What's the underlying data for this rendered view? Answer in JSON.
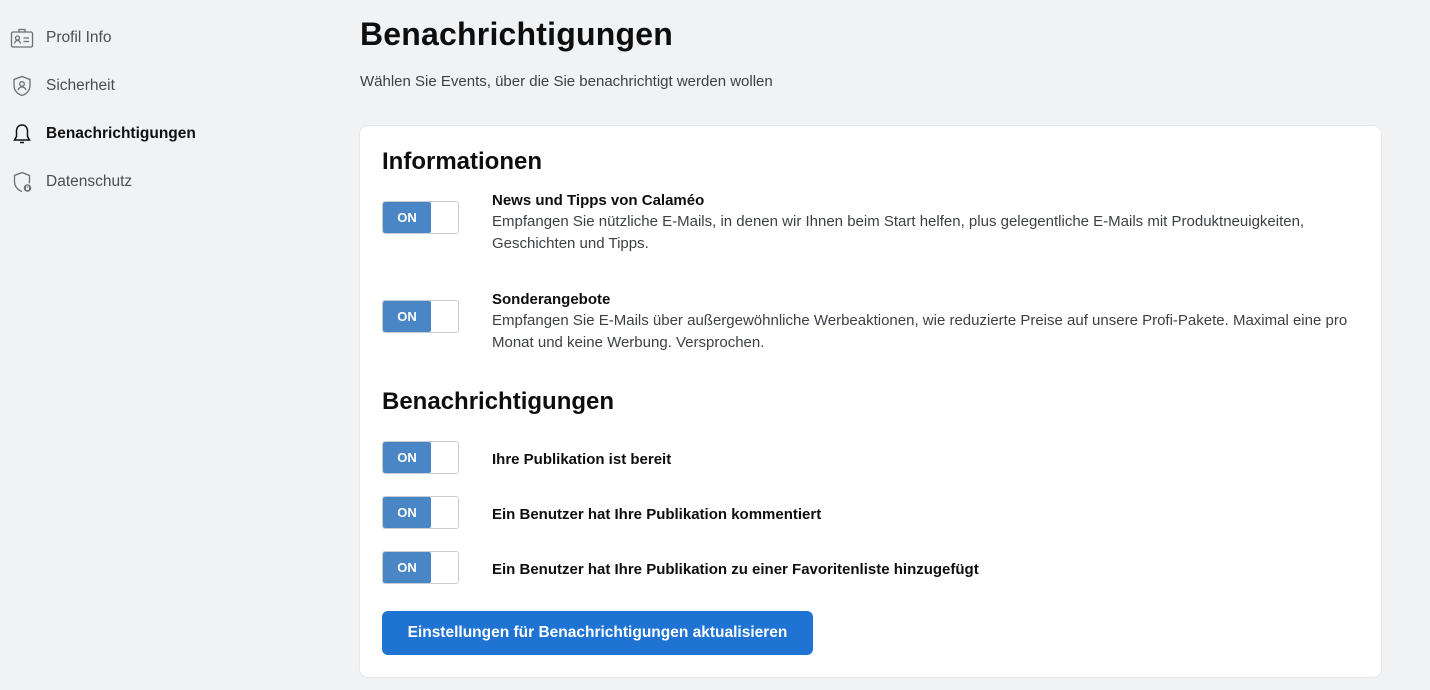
{
  "sidebar": {
    "items": [
      {
        "label": "Profil Info",
        "icon": "id-card-icon",
        "active": false
      },
      {
        "label": "Sicherheit",
        "icon": "shield-icon",
        "active": false
      },
      {
        "label": "Benachrichtigungen",
        "icon": "bell-icon",
        "active": true
      },
      {
        "label": "Datenschutz",
        "icon": "privacy-shield-icon",
        "active": false
      }
    ]
  },
  "main": {
    "title": "Benachrichtigungen",
    "subtitle": "Wählen Sie Events, über die Sie benachrichtigt werden wollen",
    "sections": [
      {
        "title": "Informationen",
        "options": [
          {
            "title": "News und Tipps von Calaméo",
            "description": "Empfangen Sie nützliche E-Mails, in denen wir Ihnen beim Start helfen, plus gelegentliche E-Mails mit Produktneuigkeiten, Geschichten und Tipps.",
            "toggle": "ON"
          },
          {
            "title": "Sonderangebote",
            "description": "Empfangen Sie E-Mails über außergewöhnliche Werbeaktionen, wie reduzierte Preise auf unsere Profi-Pakete. Maximal eine pro Monat und keine Werbung. Versprochen.",
            "toggle": "ON"
          }
        ]
      },
      {
        "title": "Benachrichtigungen",
        "options": [
          {
            "title": "Ihre Publikation ist bereit",
            "toggle": "ON"
          },
          {
            "title": "Ein Benutzer hat Ihre Publikation kommentiert",
            "toggle": "ON"
          },
          {
            "title": "Ein Benutzer hat Ihre Publikation zu einer Favoritenliste hinzugefügt",
            "toggle": "ON"
          }
        ]
      }
    ],
    "update_button": "Einstellungen für Benachrichtigungen aktualisieren"
  },
  "colors": {
    "toggle_on": "#4a86c5",
    "button": "#1f74d3",
    "background": "#f1f2f4"
  }
}
